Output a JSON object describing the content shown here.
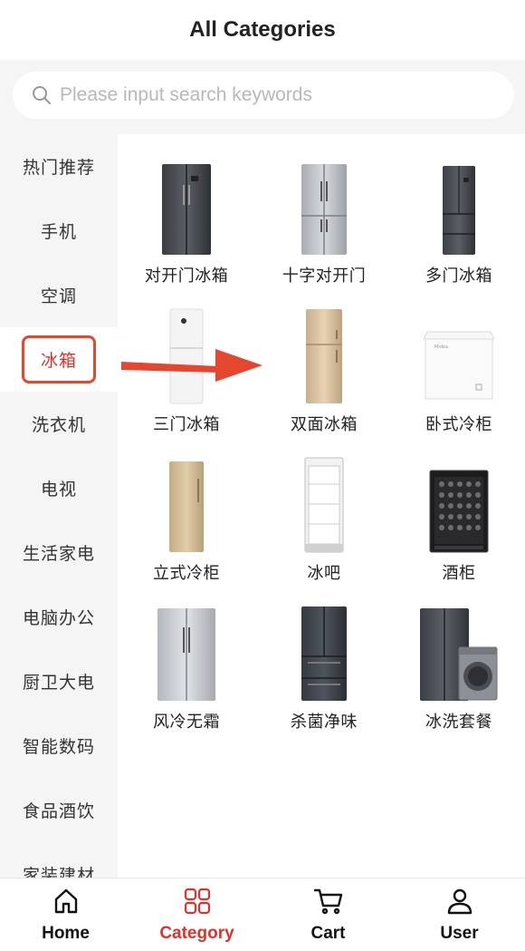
{
  "header": {
    "title": "All Categories"
  },
  "search": {
    "placeholder": "Please input search keywords"
  },
  "sidebar": {
    "items": [
      {
        "label": "热门推荐"
      },
      {
        "label": "手机"
      },
      {
        "label": "空调"
      },
      {
        "label": "冰箱",
        "active": true
      },
      {
        "label": "洗衣机"
      },
      {
        "label": "电视"
      },
      {
        "label": "生活家电"
      },
      {
        "label": "电脑办公"
      },
      {
        "label": "厨卫大电"
      },
      {
        "label": "智能数码"
      },
      {
        "label": "食品酒饮"
      },
      {
        "label": "家装建材"
      }
    ]
  },
  "products": [
    {
      "name": "对开门冰箱",
      "icon": "side-by-side-fridge-icon"
    },
    {
      "name": "十字对开门",
      "icon": "cross-door-fridge-icon"
    },
    {
      "name": "多门冰箱",
      "icon": "multi-door-fridge-icon"
    },
    {
      "name": "三门冰箱",
      "icon": "three-door-fridge-icon"
    },
    {
      "name": "双面冰箱",
      "icon": "two-door-fridge-icon"
    },
    {
      "name": "卧式冷柜",
      "icon": "chest-freezer-icon"
    },
    {
      "name": "立式冷柜",
      "icon": "upright-freezer-icon"
    },
    {
      "name": "冰吧",
      "icon": "glass-door-cooler-icon"
    },
    {
      "name": "酒柜",
      "icon": "wine-cabinet-icon"
    },
    {
      "name": "风冷无霜",
      "icon": "frost-free-fridge-icon"
    },
    {
      "name": "杀菌净味",
      "icon": "french-door-fridge-icon"
    },
    {
      "name": "冰洗套餐",
      "icon": "fridge-washer-bundle-icon"
    }
  ],
  "tabbar": {
    "items": [
      {
        "label": "Home",
        "icon": "home-icon"
      },
      {
        "label": "Category",
        "icon": "grid-icon",
        "active": true
      },
      {
        "label": "Cart",
        "icon": "cart-icon"
      },
      {
        "label": "User",
        "icon": "user-icon"
      }
    ]
  },
  "colors": {
    "accent": "#e0312a",
    "sidebar_bg": "#f5f5f5"
  }
}
